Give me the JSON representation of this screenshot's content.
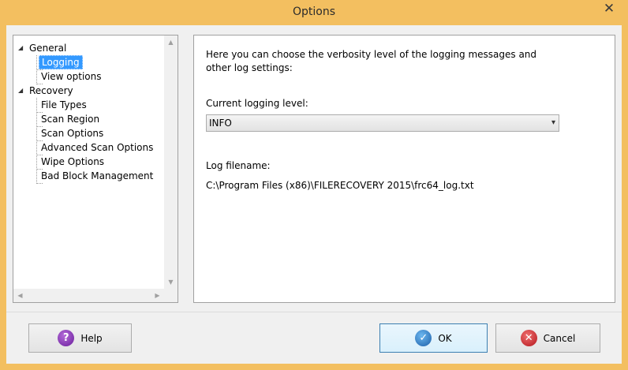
{
  "window": {
    "title": "Options",
    "close_glyph": "✕",
    "background": "#f3bf60"
  },
  "tree": {
    "groups": [
      {
        "label": "General",
        "children": [
          {
            "label": "Logging",
            "selected": true
          },
          {
            "label": "View options",
            "selected": false
          }
        ]
      },
      {
        "label": "Recovery",
        "children": [
          {
            "label": "File Types"
          },
          {
            "label": "Scan Region"
          },
          {
            "label": "Scan Options"
          },
          {
            "label": "Advanced Scan Options"
          },
          {
            "label": "Wipe Options"
          },
          {
            "label": "Bad Block Management"
          }
        ]
      }
    ],
    "selection_color": "#3399ff"
  },
  "logging": {
    "description": "Here you can choose the verbosity level of the logging messages and other log settings:",
    "level_label": "Current logging level:",
    "level_value": "INFO",
    "filename_label": "Log filename:",
    "filename_value": "C:\\Program Files (x86)\\FILERECOVERY 2015\\frc64_log.txt"
  },
  "buttons": {
    "help": "Help",
    "ok": "OK",
    "cancel": "Cancel"
  },
  "icons": {
    "help": "help-icon",
    "ok": "check-icon",
    "cancel": "cancel-icon"
  }
}
